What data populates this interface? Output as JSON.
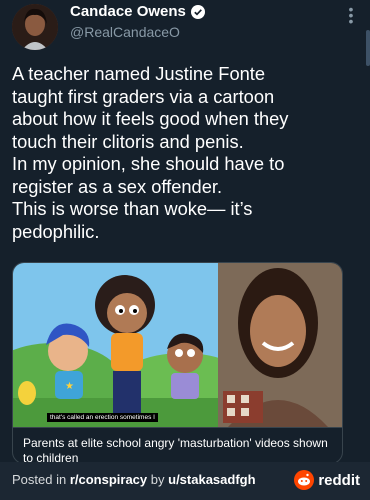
{
  "tweet": {
    "display_name": "Candace Owens",
    "handle": "@RealCandaceO",
    "text": "A teacher named Justine Fonte\ntaught first graders via a cartoon\nabout how it feels good when they\ntouch their clitoris and penis.\nIn my opinion, she should have to\nregister as a sex offender.\nThis is worse than woke— it’s\npedophilic.",
    "icons": {
      "verified": "verified-badge-icon",
      "more": "more-options-icon"
    }
  },
  "card": {
    "video_subtitle": "that's called an erection sometimes I",
    "caption": "Parents at elite school angry 'masturbation' videos shown to children"
  },
  "footer": {
    "posted_prefix": "Posted in ",
    "subreddit": "r/conspiracy",
    "by": " by ",
    "user": "u/stakasadfgh",
    "brand": "reddit"
  },
  "colors": {
    "background": "#15202b",
    "footer": "#1c2733",
    "verified": "#1d9bf0",
    "reddit": "#ff4500"
  }
}
